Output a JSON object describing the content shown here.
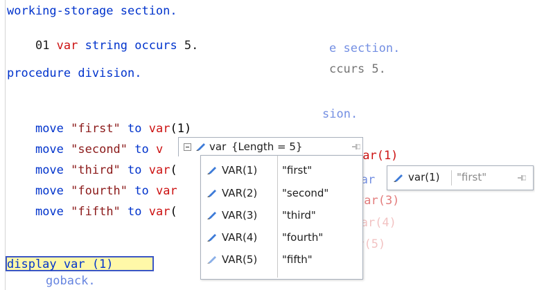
{
  "code": {
    "lines": [
      "working-storage section.",
      "01 var string occurs 5.",
      "",
      "procedure division.",
      "",
      "move \"first\" to var(1)",
      "move \"second\" to v",
      "move \"third\" to var(",
      "move \"fourth\" to var",
      "move \"fifth\" to var(",
      "",
      "display var (1)",
      "goback."
    ],
    "ghost_lines": [
      "e section.",
      "ccurs 5.",
      "sion.",
      "var(1)",
      "o var",
      "var(3)",
      "o var(4)",
      "ar(5)"
    ]
  },
  "datatip": {
    "header_name": "var",
    "header_value": "{Length = 5}",
    "items": [
      {
        "name": "VAR(1)",
        "value": "\"first\""
      },
      {
        "name": "VAR(2)",
        "value": "\"second\""
      },
      {
        "name": "VAR(3)",
        "value": "\"third\""
      },
      {
        "name": "VAR(4)",
        "value": "\"fourth\""
      },
      {
        "name": "VAR(5)",
        "value": "\"fifth\""
      }
    ]
  },
  "subtip": {
    "name": "var(1)",
    "value": "\"first\""
  },
  "colors": {
    "keyword": "#0033cc",
    "variable": "#cc1111",
    "execution_highlight": "#fff8a8",
    "execution_border": "#3a56c5"
  },
  "icons": {
    "collapse": "minus-box-icon",
    "field": "pencil-field-icon",
    "pin": "pin-icon"
  }
}
